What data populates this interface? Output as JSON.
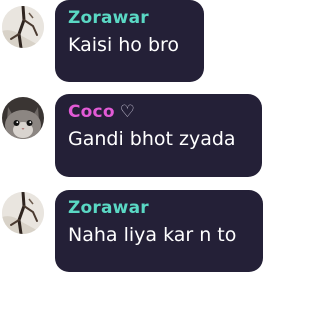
{
  "colors": {
    "bubble_bg": "#242037",
    "message_text": "#ffffff",
    "zorawar_name": "#5ad8c4",
    "coco_name": "#e25ad6",
    "heart": "#c8c3d6"
  },
  "messages": [
    {
      "sender": "Zorawar",
      "text": "Kaisi ho bro",
      "avatar_icon": "broken-tree-branch-icon",
      "name_badge": null
    },
    {
      "sender": "Coco",
      "text": "Gandi bhot zyada",
      "avatar_icon": "cat-face-icon",
      "name_badge": "♡"
    },
    {
      "sender": "Zorawar",
      "text": "Naha liya kar n to",
      "avatar_icon": "broken-tree-branch-icon",
      "name_badge": null
    }
  ]
}
